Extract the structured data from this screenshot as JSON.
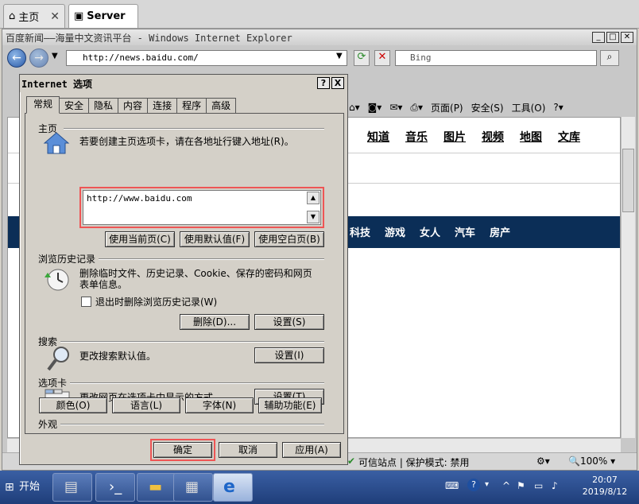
{
  "vm_tabs": [
    {
      "label": "主页",
      "icon": "home-icon"
    },
    {
      "label": "Server",
      "icon": "server-icon"
    }
  ],
  "ie": {
    "title": "百度新闻——海量中文资讯平台 - Windows Internet Explorer",
    "address": "http://news.baidu.com/",
    "search_placeholder": "Bing",
    "command_bar": {
      "page_menu": "页面(P)",
      "safety_menu": "安全(S)",
      "tools_menu": "工具(O)"
    },
    "page": {
      "top_nav": [
        "知道",
        "音乐",
        "图片",
        "视频",
        "地图",
        "文库"
      ],
      "news_categories": [
        "科技",
        "游戏",
        "女人",
        "汽车",
        "房产"
      ]
    },
    "status": {
      "zone": "可信站点 | 保护模式: 禁用",
      "zoom": "100%"
    }
  },
  "dialog": {
    "title": "Internet 选项",
    "help_label": "?",
    "close_label": "X",
    "tabs": [
      "常规",
      "安全",
      "隐私",
      "内容",
      "连接",
      "程序",
      "高级"
    ],
    "active_tab": "常规",
    "homepage": {
      "group": "主页",
      "description": "若要创建主页选项卡，请在各地址行键入地址(R)。",
      "value": "http://www.baidu.com",
      "use_current": "使用当前页(C)",
      "use_default": "使用默认值(F)",
      "use_blank": "使用空白页(B)"
    },
    "history": {
      "group": "浏览历史记录",
      "description_line1": "删除临时文件、历史记录、Cookie、保存的密码和网页",
      "description_line2": "表单信息。",
      "checkbox_label": "退出时删除浏览历史记录(W)",
      "checked": false,
      "delete_button": "删除(D)...",
      "settings_button": "设置(S)"
    },
    "search": {
      "group": "搜索",
      "description": "更改搜索默认值。",
      "settings_button": "设置(I)"
    },
    "tabs_section": {
      "group": "选项卡",
      "description": "更改网页在选项卡中显示的方式。",
      "settings_button": "设置(T)"
    },
    "appearance": {
      "group": "外观",
      "colors": "颜色(O)",
      "languages": "语言(L)",
      "fonts": "字体(N)",
      "accessibility": "辅助功能(E)"
    },
    "footer": {
      "ok": "确定",
      "cancel": "取消",
      "apply": "应用(A)"
    }
  },
  "taskbar": {
    "start_label": "开始",
    "time": "20:07",
    "date": "2019/8/12"
  }
}
